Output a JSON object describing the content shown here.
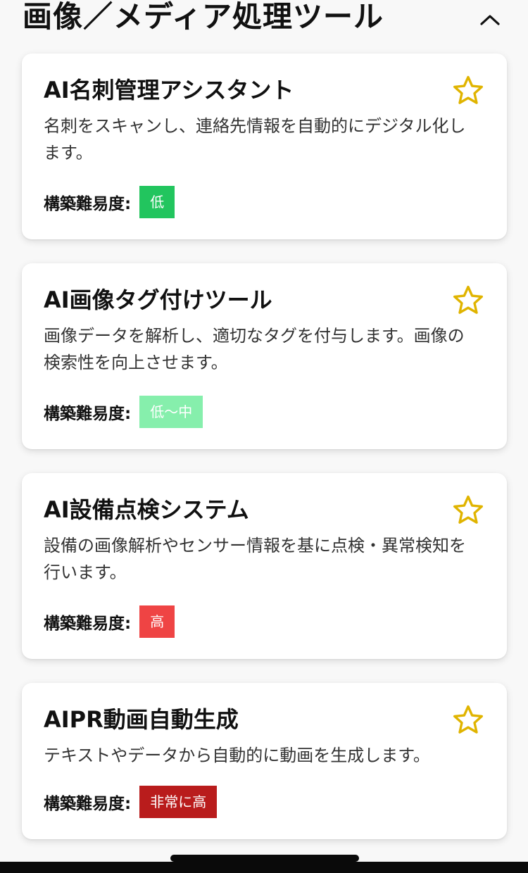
{
  "section": {
    "title": "画像／メディア処理ツール",
    "collapse_icon": "chevron-up-icon"
  },
  "colors": {
    "star": "#e0b400",
    "low": "#22c55e",
    "low_mid": "#86efac",
    "high": "#ef4444",
    "very_high": "#b91c1c"
  },
  "cards": [
    {
      "title": "AI名刺管理アシスタント",
      "description": "名刺をスキャンし、連絡先情報を自動的にデジタル化します。",
      "difficulty_label": "構築難易度:",
      "difficulty": "低",
      "difficulty_color": "#22c55e",
      "favorite_icon": "star-outline-icon"
    },
    {
      "title": "AI画像タグ付けツール",
      "description": "画像データを解析し、適切なタグを付与します。画像の検索性を向上させます。",
      "difficulty_label": "構築難易度:",
      "difficulty": "低〜中",
      "difficulty_color": "#86efac",
      "favorite_icon": "star-outline-icon"
    },
    {
      "title": "AI設備点検システム",
      "description": "設備の画像解析やセンサー情報を基に点検・異常検知を行います。",
      "difficulty_label": "構築難易度:",
      "difficulty": "高",
      "difficulty_color": "#ef4444",
      "favorite_icon": "star-outline-icon"
    },
    {
      "title": "AIPR動画自動生成",
      "description": "テキストやデータから自動的に動画を生成します。",
      "difficulty_label": "構築難易度:",
      "difficulty": "非常に高",
      "difficulty_color": "#b91c1c",
      "favorite_icon": "star-outline-icon"
    }
  ]
}
